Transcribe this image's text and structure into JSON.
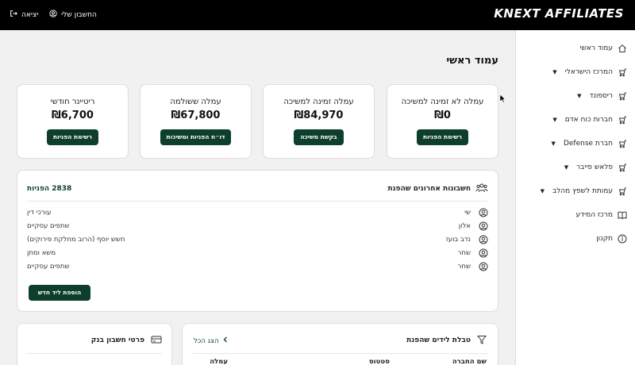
{
  "header": {
    "logo": "KNEXT AFFILIATES",
    "logout_label": "יציאה",
    "account_label": "החשבון שלי"
  },
  "sidebar": {
    "items": [
      {
        "label": "עמוד ראשי",
        "icon": "home-icon",
        "caret": false
      },
      {
        "label": "המרכז הישראלי",
        "icon": "cart-icon",
        "caret": true
      },
      {
        "label": "ריספונד",
        "icon": "cart-icon",
        "caret": true
      },
      {
        "label": "חברות כוח אדם",
        "icon": "cart-icon",
        "caret": true
      },
      {
        "label": "חברת Defense",
        "icon": "cart-icon",
        "caret": true
      },
      {
        "label": "פלאש פייבר",
        "icon": "cart-icon",
        "caret": true
      },
      {
        "label": "עמותת לשפץ מהלב",
        "icon": "cart-icon",
        "caret": true
      },
      {
        "label": "מרכז המידע",
        "icon": "book-icon",
        "caret": false
      },
      {
        "label": "תקנון",
        "icon": "info-icon",
        "caret": false
      }
    ]
  },
  "main": {
    "title": "עמוד ראשי",
    "stats": [
      {
        "label": "עמלה לא זמינה למשיכה",
        "value": "₪0",
        "button": "רשימת הפניות"
      },
      {
        "label": "עמלה זמינה למשיכה",
        "value": "₪84,970",
        "button": "בקשת משיכה"
      },
      {
        "label": "עמלה ששולמה",
        "value": "₪67,800",
        "button": "דו״ח הפניות ומשיכות"
      },
      {
        "label": "ריטיינר חודשי",
        "value": "₪6,700",
        "button": "רשימת הפניות"
      }
    ],
    "accounts": {
      "title": "חשבונות אחרונים שהפנת",
      "count": "2838 הפניות",
      "rows": [
        {
          "name": "שי",
          "firm": "עורכי דין"
        },
        {
          "name": "אלון",
          "firm": "שתפים עסקיים"
        },
        {
          "name": "נדב בועז",
          "firm": "חשש יוסף (הרוב מחלקת פירוקים)"
        },
        {
          "name": "שחר",
          "firm": "משא ומתן"
        },
        {
          "name": "שחר",
          "firm": "שתפים עסקיים"
        }
      ],
      "add_button": "הוספת ליד חדש"
    },
    "leads": {
      "title": "טבלת לידים שהפנת",
      "show_all": "הצג הכל",
      "columns": [
        "שם החברה",
        "סטטוס",
        "עמלה"
      ]
    },
    "bank": {
      "title": "פרטי חשבון בנק"
    }
  }
}
